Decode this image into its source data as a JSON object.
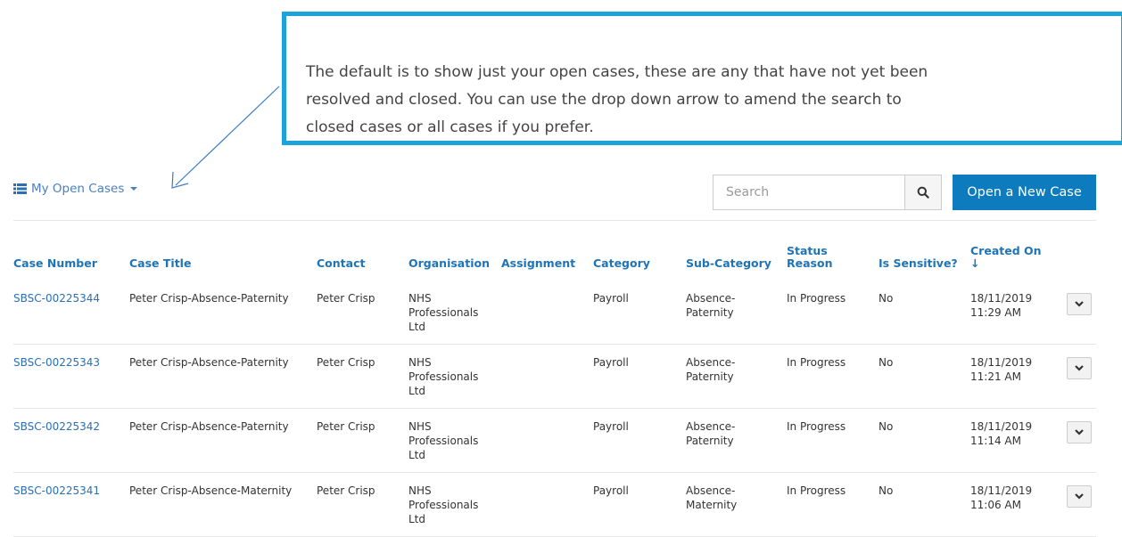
{
  "callout": {
    "text": "The default is to show just your open cases, these are any that have not yet been\nresolved and closed.  You can use the drop down arrow to amend the search to\nclosed cases or all cases if you prefer."
  },
  "toolbar": {
    "view_label": "My Open Cases",
    "search_placeholder": "Search",
    "new_case_label": "Open a New Case"
  },
  "table": {
    "headers": {
      "case_number": "Case Number",
      "case_title": "Case Title",
      "contact": "Contact",
      "organisation": "Organisation",
      "assignment": "Assignment",
      "category": "Category",
      "sub_category": "Sub-Category",
      "status_reason_1": "Status",
      "status_reason_2": "Reason",
      "is_sensitive": "Is Sensitive?",
      "created_on": "Created On",
      "sort_indicator": "↓"
    },
    "rows": [
      {
        "case_number": "SBSC-00225344",
        "title": "Peter Crisp-Absence-Paternity",
        "contact": "Peter Crisp",
        "org_1": "NHS",
        "org_2": "Professionals",
        "org_3": "Ltd",
        "assignment": "",
        "category": "Payroll",
        "sub_1": "Absence-",
        "sub_2": "Paternity",
        "status": "In Progress",
        "sensitive": "No",
        "date": "18/11/2019",
        "time": "11:29 AM"
      },
      {
        "case_number": "SBSC-00225343",
        "title": "Peter Crisp-Absence-Paternity",
        "contact": "Peter Crisp",
        "org_1": "NHS",
        "org_2": "Professionals",
        "org_3": "Ltd",
        "assignment": "",
        "category": "Payroll",
        "sub_1": "Absence-",
        "sub_2": "Paternity",
        "status": "In Progress",
        "sensitive": "No",
        "date": "18/11/2019",
        "time": "11:21 AM"
      },
      {
        "case_number": "SBSC-00225342",
        "title": "Peter Crisp-Absence-Paternity",
        "contact": "Peter Crisp",
        "org_1": "NHS",
        "org_2": "Professionals",
        "org_3": "Ltd",
        "assignment": "",
        "category": "Payroll",
        "sub_1": "Absence-",
        "sub_2": "Paternity",
        "status": "In Progress",
        "sensitive": "No",
        "date": "18/11/2019",
        "time": "11:14 AM"
      },
      {
        "case_number": "SBSC-00225341",
        "title": "Peter Crisp-Absence-Maternity",
        "contact": "Peter Crisp",
        "org_1": "NHS",
        "org_2": "Professionals",
        "org_3": "Ltd",
        "assignment": "",
        "category": "Payroll",
        "sub_1": "Absence-",
        "sub_2": "Maternity",
        "status": "In Progress",
        "sensitive": "No",
        "date": "18/11/2019",
        "time": "11:06 AM"
      }
    ]
  },
  "colors": {
    "callout_border": "#1ca3d9",
    "link": "#2a6fb6",
    "header": "#1f74b8",
    "primary_button": "#0d7bbd"
  },
  "icons": [
    "list-icon",
    "caret-down-icon",
    "search-icon",
    "chevron-down-icon",
    "sort-down-arrow-icon",
    "annotation-arrow"
  ]
}
